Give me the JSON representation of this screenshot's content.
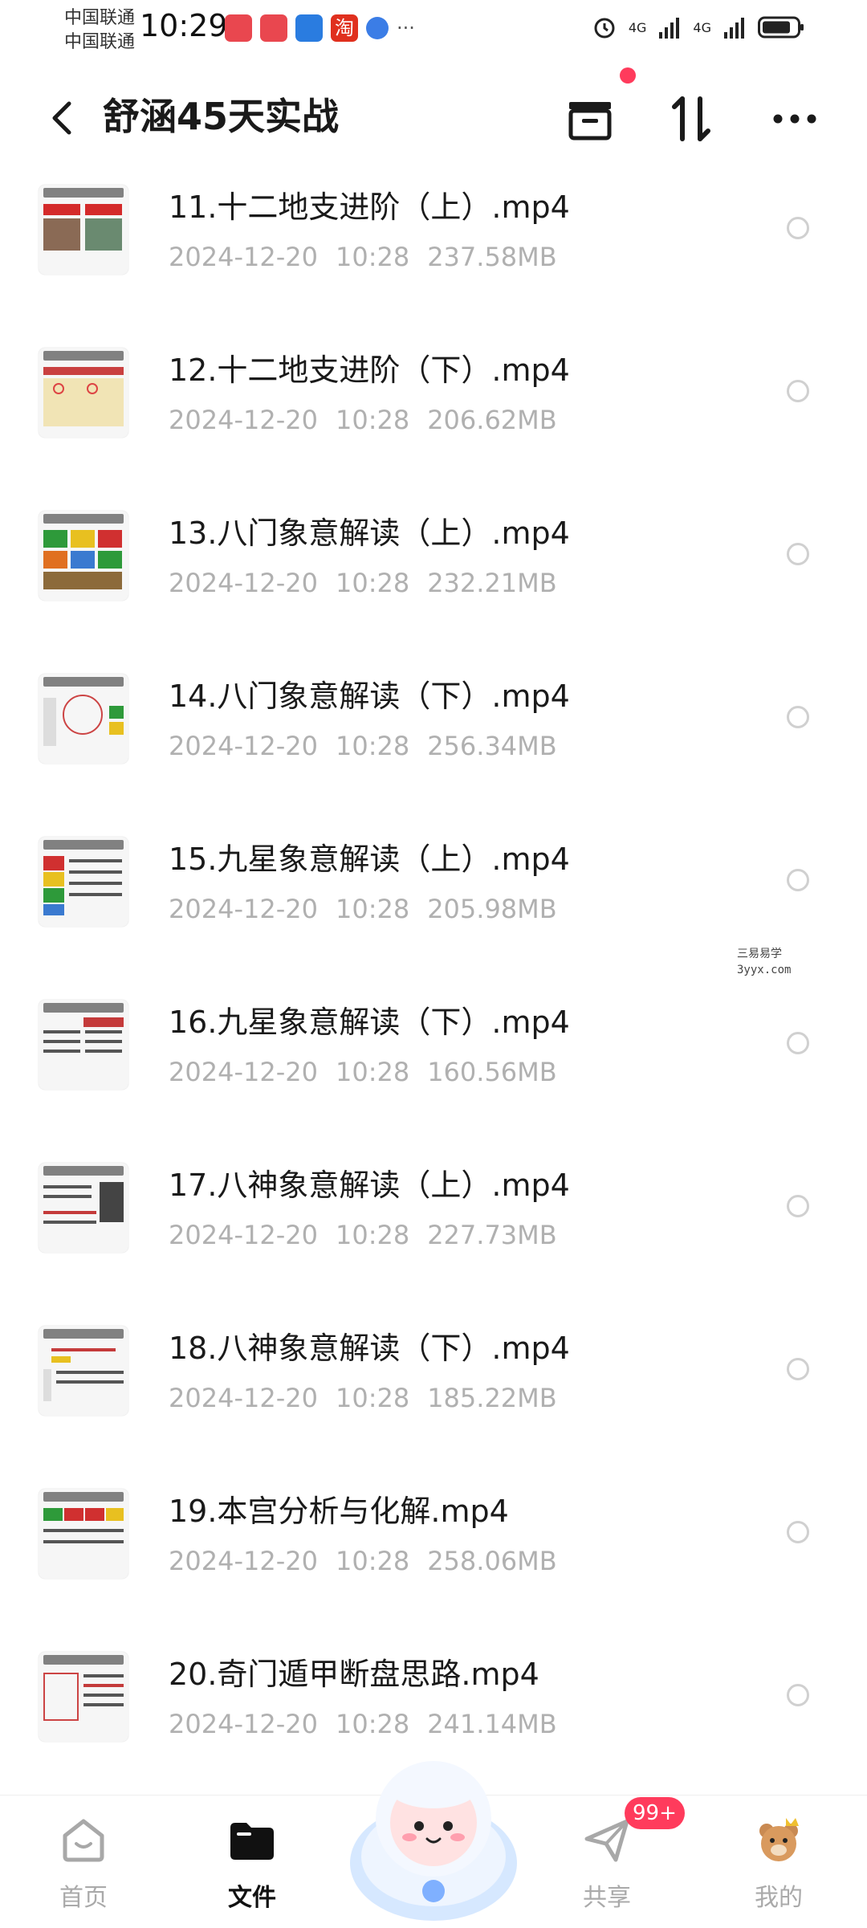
{
  "status_bar": {
    "carrier_1": "中国联通",
    "carrier_2": "中国联通",
    "time": "10:29",
    "net_1": "4G",
    "net_2": "4G",
    "app_icon_5": "淘"
  },
  "header": {
    "title": "舒涵45天实战"
  },
  "files": [
    {
      "name": "11.十二地支进阶（上）.mp4",
      "date": "2024-12-20",
      "time": "10:28",
      "size": "237.58MB"
    },
    {
      "name": "12.十二地支进阶（下）.mp4",
      "date": "2024-12-20",
      "time": "10:28",
      "size": "206.62MB"
    },
    {
      "name": "13.八门象意解读（上）.mp4",
      "date": "2024-12-20",
      "time": "10:28",
      "size": "232.21MB"
    },
    {
      "name": "14.八门象意解读（下）.mp4",
      "date": "2024-12-20",
      "time": "10:28",
      "size": "256.34MB"
    },
    {
      "name": "15.九星象意解读（上）.mp4",
      "date": "2024-12-20",
      "time": "10:28",
      "size": "205.98MB"
    },
    {
      "name": "16.九星象意解读（下）.mp4",
      "date": "2024-12-20",
      "time": "10:28",
      "size": "160.56MB"
    },
    {
      "name": "17.八神象意解读（上）.mp4",
      "date": "2024-12-20",
      "time": "10:28",
      "size": "227.73MB"
    },
    {
      "name": "18.八神象意解读（下）.mp4",
      "date": "2024-12-20",
      "time": "10:28",
      "size": "185.22MB"
    },
    {
      "name": "19.本宫分析与化解.mp4",
      "date": "2024-12-20",
      "time": "10:28",
      "size": "258.06MB"
    },
    {
      "name": "20.奇门遁甲断盘思路.mp4",
      "date": "2024-12-20",
      "time": "10:28",
      "size": "241.14MB"
    }
  ],
  "watermark": {
    "line1": "三易易学",
    "line2": "3yyx.com"
  },
  "bottom_nav": {
    "home": "首页",
    "files": "文件",
    "share": "共享",
    "mine": "我的",
    "share_badge": "99+"
  },
  "colors": {
    "accent": "#ff3b5c",
    "meta_text": "#b0b0b0"
  }
}
